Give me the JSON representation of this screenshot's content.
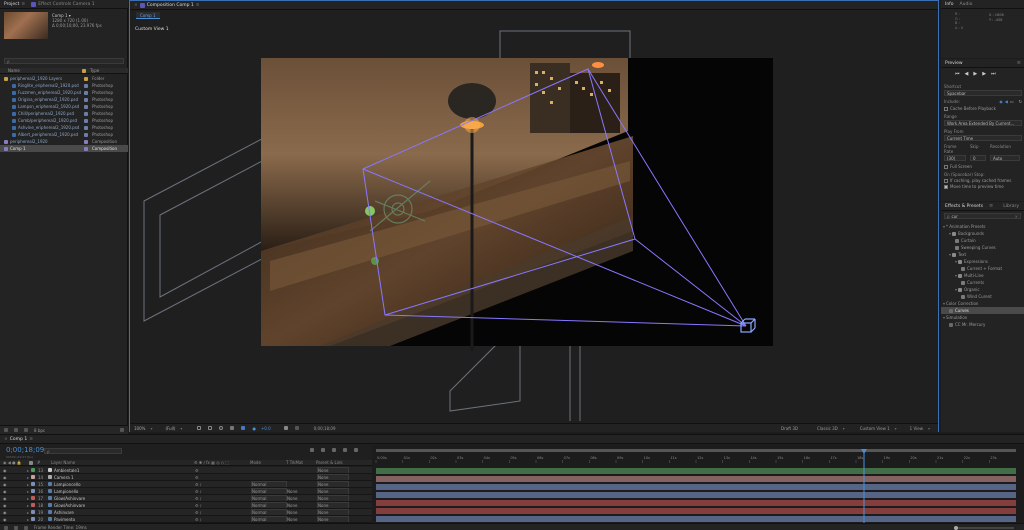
{
  "project": {
    "tabs": [
      "Project",
      "Effect Controls Camera 1"
    ],
    "comp_name": "Comp 1 ▾",
    "comp_info1": "1280 x 720 (1.00)",
    "comp_info2": "Δ 0;00;10;00, 23.976 fps",
    "search_placeholder": "ρ",
    "col_name": "Name",
    "col_type": "Type",
    "items": [
      {
        "name": "periphereal2_1920 Layers",
        "type": "Folder",
        "level": 0,
        "kind": "folder"
      },
      {
        "name": "Ringlite_eriphereal2_1920.psd",
        "type": "Photoshop",
        "level": 1,
        "kind": "psd"
      },
      {
        "name": "Fuzzmen_eriphereal2_1920.psd",
        "type": "Photoshop",
        "level": 1,
        "kind": "psd"
      },
      {
        "name": "Origina_eriphereal2_1920.psd",
        "type": "Photoshop",
        "level": 1,
        "kind": "psd"
      },
      {
        "name": "Lampsn_eriphereal2_1920.psd",
        "type": "Photoshop",
        "level": 1,
        "kind": "psd"
      },
      {
        "name": "Chill/periphereal2_1920.psd",
        "type": "Photoshop",
        "level": 1,
        "kind": "psd"
      },
      {
        "name": "Comb/periphereal2_1920.psd",
        "type": "Photoshop",
        "level": 1,
        "kind": "psd"
      },
      {
        "name": "Ashvine_eriphereal2_1920.psd",
        "type": "Photoshop",
        "level": 1,
        "kind": "psd"
      },
      {
        "name": "Albert_periphereal2_1920.psd",
        "type": "Photoshop",
        "level": 1,
        "kind": "psd"
      },
      {
        "name": "periphereal2_1920",
        "type": "Composition",
        "level": 0,
        "kind": "comp"
      },
      {
        "name": "Comp 1",
        "type": "Composition",
        "level": 0,
        "kind": "comp",
        "selected": true
      }
    ],
    "footer": "8 bpc"
  },
  "viewer": {
    "tab": "Composition Comp 1",
    "sub_tab": "Comp 1",
    "view_label": "Custom View 1",
    "zoom": "100%",
    "resolution": "(Full)",
    "exposure": "+0.0",
    "timecode": "0;00;18;09",
    "renderer_label": "Draft 3D",
    "renderer": "Classic 3D",
    "view_select": "Custom View 1",
    "views": "1 View"
  },
  "info": {
    "tabs": [
      "Info",
      "Audio"
    ],
    "x": "X : 1606",
    "y": "Y : -458"
  },
  "preview": {
    "title": "Preview",
    "shortcut_label": "Shortcut",
    "shortcut_value": "Spacebar",
    "include_label": "Include:",
    "cache_label": "Cache Before Playback",
    "range_label": "Range",
    "range_value": "Work Area Extended By Current...",
    "play_from_label": "Play From",
    "play_from_value": "Current Time",
    "frame_rate_label": "Frame Rate",
    "skip_label": "Skip",
    "resolution_label": "Resolution",
    "frame_rate_value": "(30)",
    "skip_value": "0",
    "resolution_value": "Auto",
    "fullscreen_label": "Full Screen",
    "on_stop_label": "On (Spacebar) Stop:",
    "if_caching": "If caching, play cached frames",
    "move_time": "Move time to preview time"
  },
  "effects": {
    "tabs": [
      "Effects & Presets",
      "Library"
    ],
    "search_value": "cur",
    "tree": [
      {
        "label": "* Animation Presets",
        "level": 0,
        "kind": "group"
      },
      {
        "label": "Backgrounds",
        "level": 1,
        "kind": "folder"
      },
      {
        "label": "Curtain",
        "level": 2,
        "kind": "preset"
      },
      {
        "label": "Sweeping Curves",
        "level": 2,
        "kind": "preset"
      },
      {
        "label": "Text",
        "level": 1,
        "kind": "folder"
      },
      {
        "label": "Expressions",
        "level": 2,
        "kind": "folder"
      },
      {
        "label": "Current + Format",
        "level": 3,
        "kind": "preset"
      },
      {
        "label": "Multi-Line",
        "level": 2,
        "kind": "folder"
      },
      {
        "label": "Currents",
        "level": 3,
        "kind": "preset"
      },
      {
        "label": "Organic",
        "level": 2,
        "kind": "folder"
      },
      {
        "label": "Wind Curent",
        "level": 3,
        "kind": "preset"
      },
      {
        "label": "Color Correction",
        "level": 0,
        "kind": "group"
      },
      {
        "label": "Curves",
        "level": 1,
        "kind": "effect",
        "selected": true
      },
      {
        "label": "Simulation",
        "level": 0,
        "kind": "group"
      },
      {
        "label": "CC Mr. Mercury",
        "level": 1,
        "kind": "effect"
      }
    ]
  },
  "timeline": {
    "tab": "Comp 1",
    "timecode": "0;00;18;09",
    "fps_note": "00549 (29.97 fps)",
    "search_placeholder": "ρ",
    "columns": {
      "num": "#",
      "name": "Layer Name",
      "mode": "Mode",
      "trkmat": "T TrkMat",
      "parent": "Parent & Link"
    },
    "layers": [
      {
        "num": "13",
        "name": "Ambientale1",
        "color": "#4a9a5a",
        "mode": "",
        "trk": "",
        "parent": "None",
        "type": "light"
      },
      {
        "num": "14",
        "name": "Camera 1",
        "color": "#c7a0a0",
        "mode": "",
        "trk": "",
        "parent": "None",
        "type": "camera"
      },
      {
        "num": "15",
        "name": "Lampioncello",
        "color": "#7b8fb8",
        "mode": "Normal",
        "trk": "",
        "parent": "None",
        "type": "psd"
      },
      {
        "num": "16",
        "name": "Lampionello",
        "color": "#7b8fb8",
        "mode": "Normal",
        "trk": "None",
        "parent": "None",
        "type": "psd"
      },
      {
        "num": "17",
        "name": "Glow/Ashinvare",
        "color": "#c25a5a",
        "mode": "Normal",
        "trk": "None",
        "parent": "None",
        "type": "psd"
      },
      {
        "num": "18",
        "name": "Glow/Ashinvare",
        "color": "#c25a5a",
        "mode": "Normal",
        "trk": "None",
        "parent": "None",
        "type": "psd"
      },
      {
        "num": "19",
        "name": "Ashinvare",
        "color": "#7b8fb8",
        "mode": "Normal",
        "trk": "None",
        "parent": "None",
        "type": "psd"
      },
      {
        "num": "20",
        "name": "Pavimento",
        "color": "#7b8fb8",
        "mode": "Normal",
        "trk": "None",
        "parent": "None",
        "type": "psd"
      }
    ],
    "ruler": [
      "0:00s",
      "01s",
      "02s",
      "03s",
      "04s",
      "05s",
      "06s",
      "07s",
      "08s",
      "09s",
      "10s",
      "11s",
      "12s",
      "13s",
      "14s",
      "15s",
      "16s",
      "17s",
      "18s",
      "19s",
      "20s",
      "21s",
      "22s",
      "23s"
    ],
    "playhead_seconds": 18.3,
    "ruler_max_seconds": 24,
    "track_colors": [
      "#4f8a55",
      "#a77a7a",
      "#6a7ea8",
      "#6a7ea8",
      "#a84a4a",
      "#a84a4a",
      "#6a7ea8",
      "#6a7ea8"
    ],
    "footer": "Frame Render Time: 19ms"
  }
}
